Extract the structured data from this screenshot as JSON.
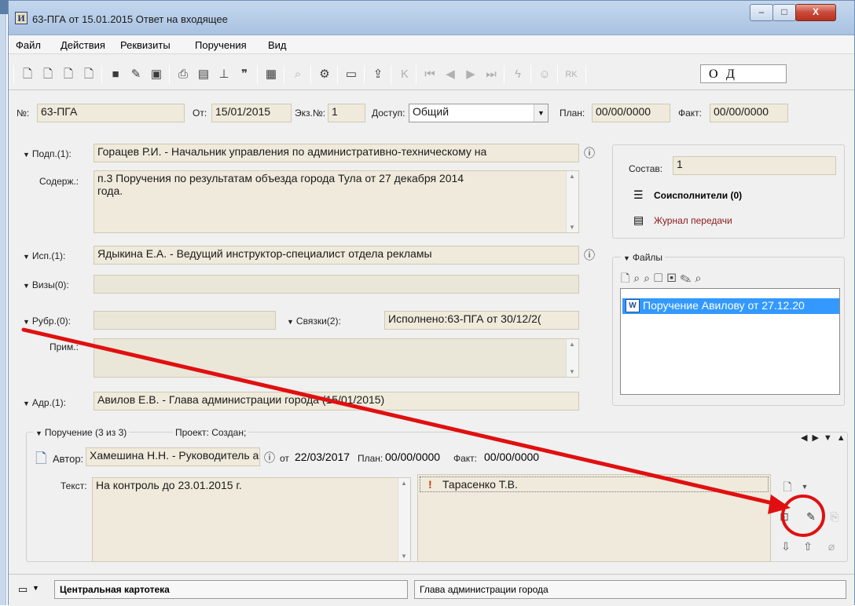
{
  "window": {
    "title": "63-ПГА от 15.01.2015 Ответ на входящее",
    "app_icon": "И",
    "controls": {
      "minimize": "–",
      "maximize": "□",
      "close": "X"
    }
  },
  "menu": [
    "Файл",
    "Действия",
    "Реквизиты",
    "Поручения",
    "Вид"
  ],
  "toolbar": {
    "icons": [
      "new-doc-icon",
      "new-doc-copy-icon",
      "new-doc-tree-icon",
      "new-doc-link-icon",
      "stop-icon",
      "edit-icon",
      "edit2-icon",
      "print-icon",
      "preview-icon",
      "stamp-icon",
      "quote-icon",
      "register-icon",
      "find-icon",
      "tools-icon",
      "card-icon",
      "send-icon",
      "rk-link-icon",
      "first-icon",
      "prev-icon",
      "next-icon",
      "last-icon",
      "flash-icon",
      "user-icon",
      "rk-icon"
    ],
    "od": [
      "О",
      "Д"
    ]
  },
  "doc": {
    "number_label": "№:",
    "number": "63-ПГА",
    "from_label": "От:",
    "from_date": "15/01/2015",
    "copy_label": "Экз.№:",
    "copy_no": "1",
    "access_label": "Доступ:",
    "access_value": "Общий",
    "plan_label": "План:",
    "plan_date": "00/00/0000",
    "fact_label": "Факт:",
    "fact_date": "00/00/0000"
  },
  "fields": {
    "podp_label": "Подп.(1):",
    "podp_value": "Горацев Р.И. - Начальник управления по административно-техническому на",
    "sod_label": "Содерж.:",
    "sod_value_line1": "п.3 Поручения по результатам объезда города Тула от 27 декабря 2014",
    "sod_value_line2": "года.",
    "isp_label": "Исп.(1):",
    "isp_value": "Ядыкина Е.А. - Ведущий инструктор-специалист отдела рекламы",
    "vizy_label": "Визы(0):",
    "rubr_label": "Рубр.(0):",
    "svyazki_label": "Связки(2):",
    "svyazki_value": "Исполнено:63-ПГА от 30/12/2(",
    "prim_label": "Прим.:",
    "adr_label": "Адр.(1):",
    "adr_value": "Авилов Е.В. - Глава администрации города (15/01/2015)"
  },
  "right_panel": {
    "sostav_label": "Состав:",
    "sostav_value": "1",
    "soisp": "Соисполнители (0)",
    "journal": "Журнал передачи",
    "files_label": "Файлы",
    "file_item": "Поручение Авилову от 27.12.20"
  },
  "assignment": {
    "header": "Поручение (3 из 3)",
    "project": "Проект: Создан;",
    "author_label": "Автор:",
    "author_value": "Хамешина Н.Н. - Руководитель аппара",
    "from_label": "от",
    "from_date": "22/03/2017",
    "plan_label": "План:",
    "plan_date": "00/00/0000",
    "fact_label": "Факт:",
    "fact_date": "00/00/0000",
    "text_label": "Текст:",
    "text_value": "На контроль до 23.01.2015 г.",
    "executor_mark": "!",
    "executor": "Тарасенко Т.В."
  },
  "status": {
    "cell1": "Центральная картотека",
    "cell2": "Глава администрации города"
  },
  "colors": {
    "field_bg": "#efeadb",
    "journal_red": "#8b1a1a",
    "annotation_red": "#e01010",
    "selection_blue": "#3399ff"
  }
}
